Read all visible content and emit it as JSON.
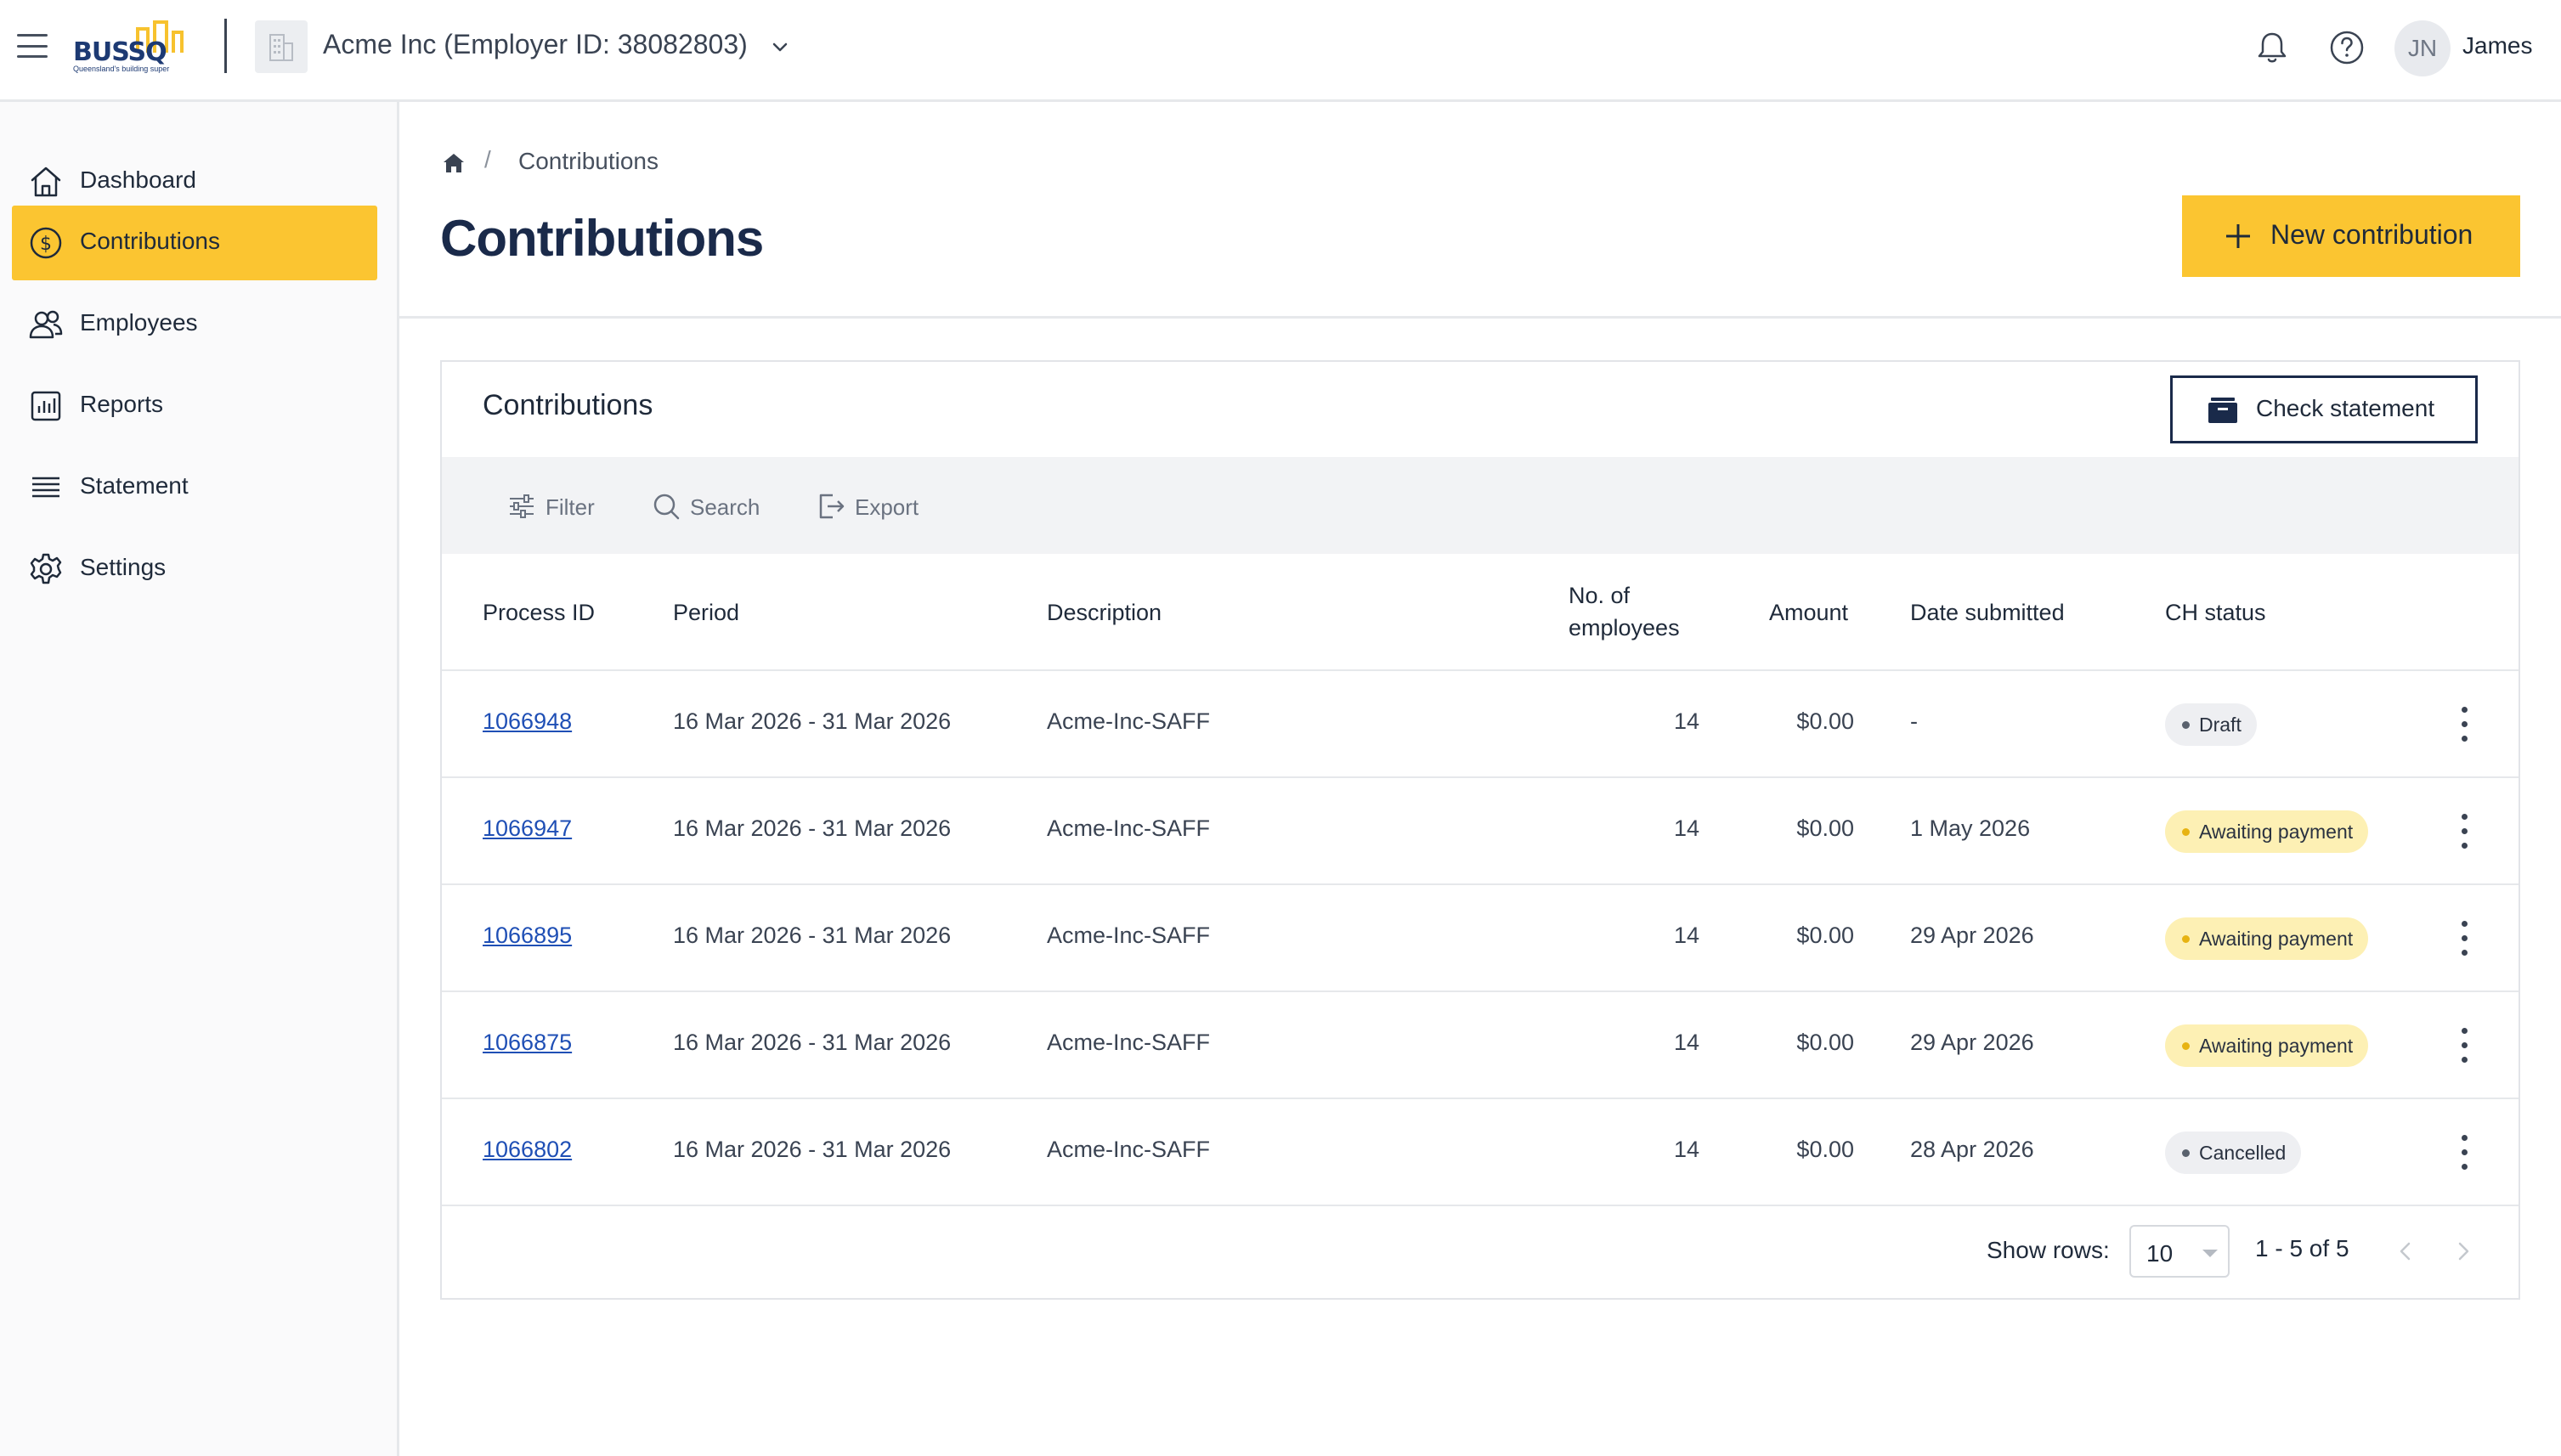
{
  "app": {
    "logo_text": "BUSSQ",
    "logo_tagline": "Queensland's building super",
    "organisation": "Acme Inc (Employer ID: 38082803)",
    "user_initials": "JN",
    "user_name": "James"
  },
  "sidebar": {
    "items": [
      {
        "label": "Dashboard",
        "icon": "home-icon",
        "active": false
      },
      {
        "label": "Contributions",
        "icon": "dollar-circle-icon",
        "active": true
      },
      {
        "label": "Employees",
        "icon": "users-icon",
        "active": false
      },
      {
        "label": "Reports",
        "icon": "bar-chart-icon",
        "active": false
      },
      {
        "label": "Statement",
        "icon": "list-icon",
        "active": false
      },
      {
        "label": "Settings",
        "icon": "gear-icon",
        "active": false
      }
    ]
  },
  "breadcrumb": {
    "separator": "/",
    "current": "Contributions"
  },
  "page": {
    "title": "Contributions",
    "new_button": "New contribution"
  },
  "card": {
    "title": "Contributions",
    "check_button": "Check statement",
    "toolbar": {
      "filter": "Filter",
      "search": "Search",
      "export": "Export"
    },
    "columns": {
      "process_id": "Process ID",
      "period": "Period",
      "description": "Description",
      "employees_line1": "No. of",
      "employees_line2": "employees",
      "amount": "Amount",
      "date_submitted": "Date submitted",
      "status": "CH status"
    },
    "rows": [
      {
        "process_id": "1066948",
        "period": "16 Mar 2026 - 31 Mar 2026",
        "description": "Acme-Inc-SAFF",
        "employees": "14",
        "amount": "$0.00",
        "date_submitted": "-",
        "status": "Draft",
        "status_color": "#eeeff2"
      },
      {
        "process_id": "1066947",
        "period": "16 Mar 2026 - 31 Mar 2026",
        "description": "Acme-Inc-SAFF",
        "employees": "14",
        "amount": "$0.00",
        "date_submitted": "1 May 2026",
        "status": "Awaiting payment",
        "status_color": "#fdf0b4"
      },
      {
        "process_id": "1066895",
        "period": "16 Mar 2026 - 31 Mar 2026",
        "description": "Acme-Inc-SAFF",
        "employees": "14",
        "amount": "$0.00",
        "date_submitted": "29 Apr 2026",
        "status": "Awaiting payment",
        "status_color": "#fdf0b4"
      },
      {
        "process_id": "1066875",
        "period": "16 Mar 2026 - 31 Mar 2026",
        "description": "Acme-Inc-SAFF",
        "employees": "14",
        "amount": "$0.00",
        "date_submitted": "29 Apr 2026",
        "status": "Awaiting payment",
        "status_color": "#fdf0b4"
      },
      {
        "process_id": "1066802",
        "period": "16 Mar 2026 - 31 Mar 2026",
        "description": "Acme-Inc-SAFF",
        "employees": "14",
        "amount": "$0.00",
        "date_submitted": "28 Apr 2026",
        "status": "Cancelled",
        "status_color": "#eeeff2"
      }
    ],
    "pagination": {
      "show_rows_label": "Show rows:",
      "rows_value": "10",
      "range": "1 - 5 of 5"
    }
  },
  "colors": {
    "accent": "#fbc531",
    "navy": "#1a2a4a",
    "link": "#1f4fb5"
  }
}
